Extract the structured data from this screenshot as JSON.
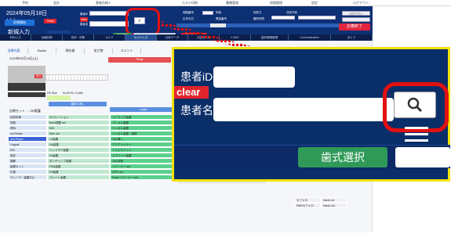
{
  "top_menu": [
    "予約",
    "会計",
    "患者台帳ト",
    "カルテ印刷",
    "書類管理",
    "保険管理",
    "設定",
    "ログアウト"
  ],
  "header": {
    "date": "2024年05月18日(土)",
    "today_button": "Today",
    "new_consult_label": "新規入力",
    "consult_start_button": "診療開始",
    "consult_end_button": "診療終了",
    "patient_id_label": "患者iD",
    "clear_label": "clear",
    "patient_name_label": "患者名",
    "dental_select_button": "歯式選択",
    "logout_label": "ログアウト",
    "insurance_label": "保険番号",
    "age_label": "年齢",
    "birth_label": "生年月日",
    "phone_label": "電話番号",
    "visit_label": "初診日",
    "last_visit_label": "最終来院",
    "next_label": "次回予約",
    "counter": "3",
    "info_button": "i",
    "tag_label": "E",
    "status_label": "お大事に"
  },
  "nav_tabs": [
    "予約/入力",
    "治療記録",
    "初診・診断",
    "カルテ",
    "カルテ入力",
    "分析データ",
    "口腔内写真",
    "X-RAY",
    "歯科健康管理",
    "Communication",
    "あとで"
  ],
  "sub_tabs": [
    "治療内容",
    "Elastic",
    "現在歯",
    "加工物",
    "コメント"
  ],
  "left_panel": {
    "date": "2024年05月18日(土)",
    "hs_label": "HS Size",
    "elastic_label": "ELASTIC /Cuttie",
    "print_button": "歯科1:消し",
    "add_button": "追加"
  },
  "today_label": "Today",
  "upper_label": "Upper",
  "section_title": "治療セット → SR看護",
  "categories": [
    "初診料等",
    "診断",
    "資料",
    "1st Phase",
    "2nd Phase",
    "Lingual",
    "IDS",
    "保定",
    "調節",
    "装置セット",
    "付属",
    "ウレーブ・装置中止"
  ],
  "col2": [
    "セパレーション",
    "Band調整 set",
    "IDB",
    "Wire set",
    "LA装置",
    "HA装置",
    "ヘッドギア装置",
    "Hs装置",
    "タンチャップ装置",
    "FMA装置",
    "FH装置",
    "プレート装置"
  ],
  "col3": [
    "ユーラック装置",
    "プレカル装置",
    "リンガル装置",
    "リンガル装置・調節",
    "TAD挿入",
    "アクアライナー",
    "インビザライン",
    "スプリント装置",
    "Opt-評価",
    "リテーナー set",
    "QPIT set",
    "Fixed リテーナー set"
  ],
  "col5": [
    "セファロ",
    "PAN/セファロ"
  ],
  "col6": [
    "Hand Lid",
    "Hand List"
  ]
}
